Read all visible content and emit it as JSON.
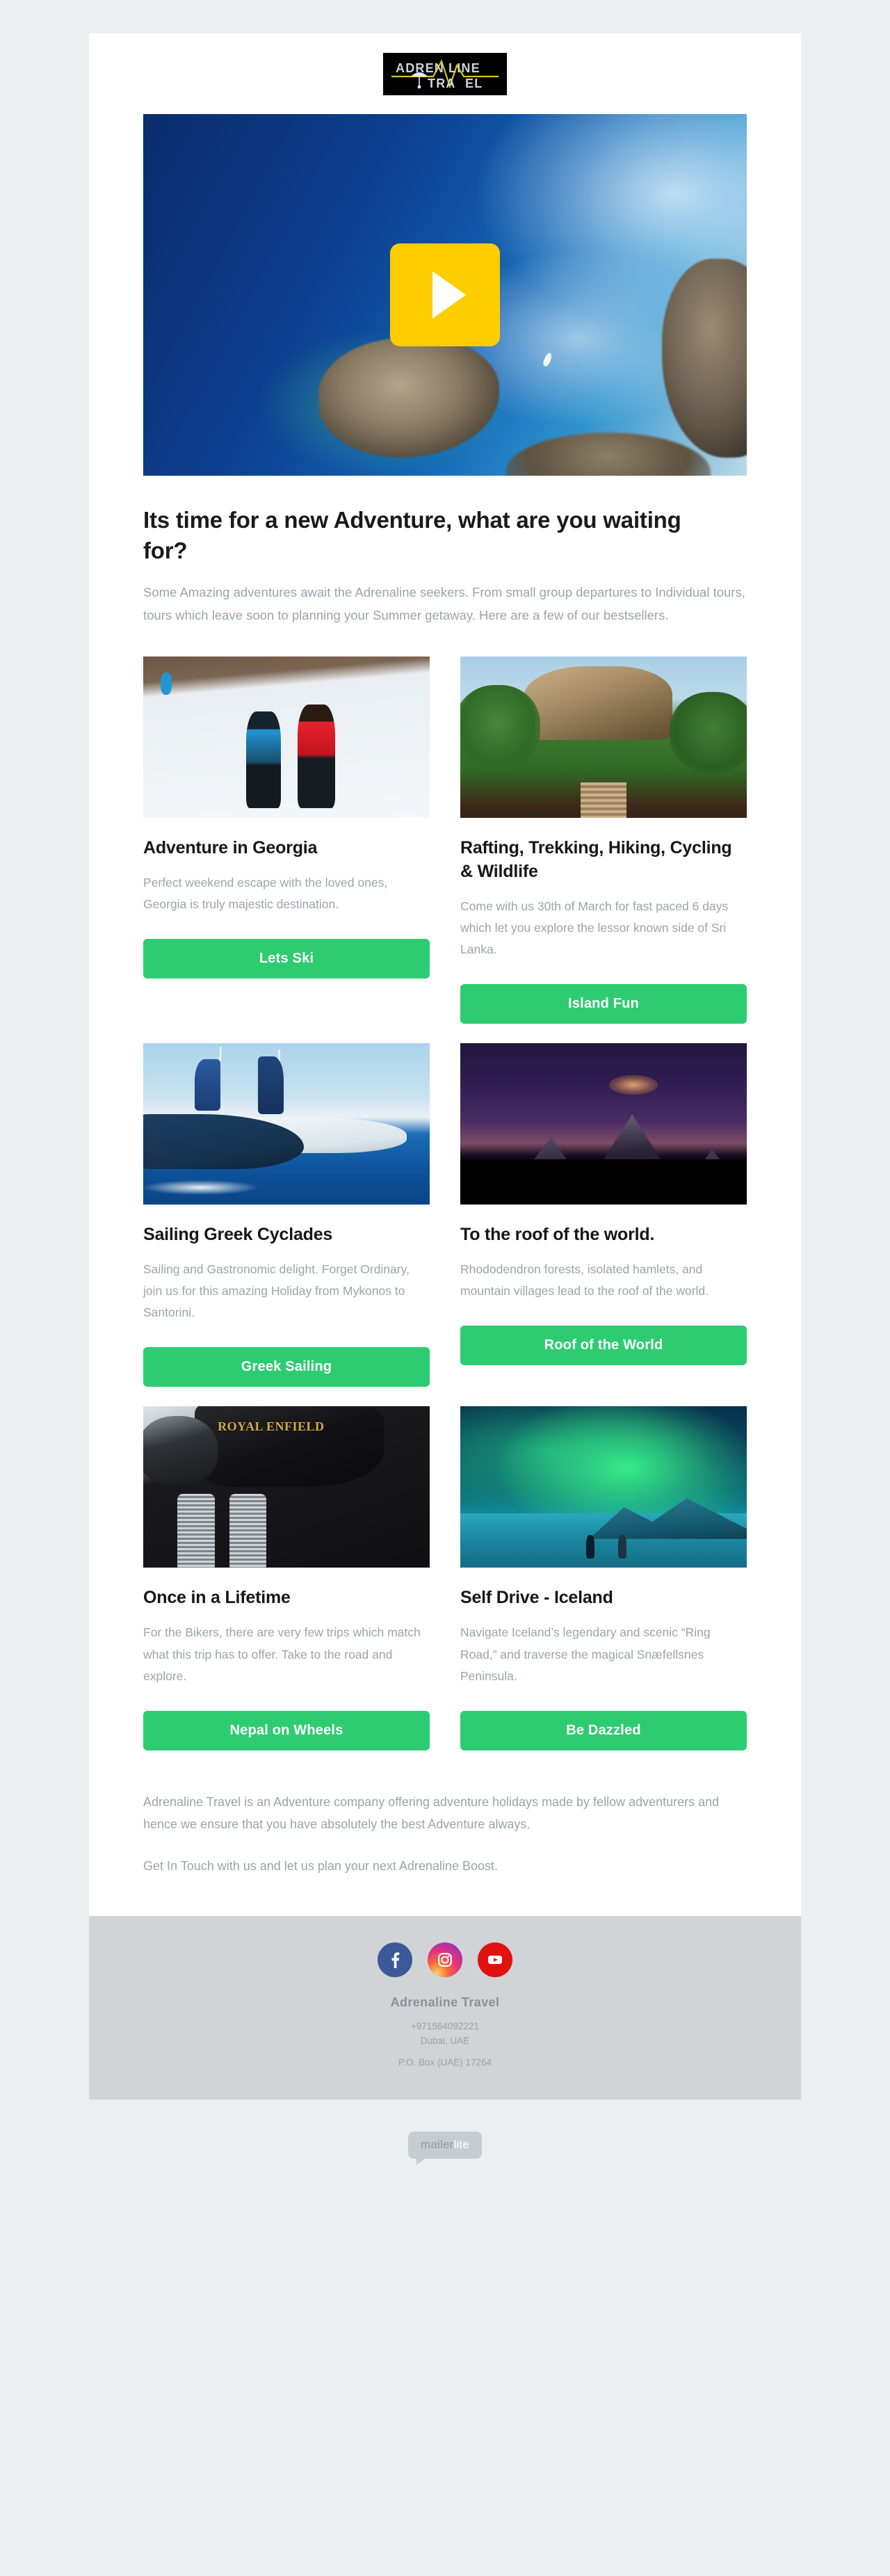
{
  "brand": {
    "logo_line1": "ADRENALINE",
    "logo_line2": "TRAVEL",
    "logo_alt": "adrenaline-travel-logo",
    "accent_green": "#2ecc71",
    "accent_yellow": "#ffcd00",
    "page_bg": "#eceff0",
    "footer_bg": "#d0d4d6"
  },
  "hero": {
    "alt": "aerial view of rocky coastline and deep blue ocean",
    "play_button_label": "Play video"
  },
  "intro": {
    "headline": "Its time for a new Adventure, what are you waiting for?",
    "body": "Some Amazing adventures await the Adrenaline seekers. From small group departures to Individual tours, tours which leave soon to planning your Summer getaway. Here are a few of our bestsellers."
  },
  "cards": [
    {
      "image_alt": "two cross-country skiers on a snowy trail",
      "title": "Adventure in Georgia",
      "description": "Perfect weekend escape with the loved ones, Georgia is truly majestic destination.",
      "cta_label": "Lets Ski"
    },
    {
      "image_alt": "Sigiriya rock fortress above green jungle, Sri Lanka",
      "title": "Rafting, Trekking, Hiking, Cycling & Wildlife",
      "description": "Come with us 30th of March for fast paced 6 days which let you explore the lessor known side of Sri Lanka.",
      "cta_label": "Island Fun"
    },
    {
      "image_alt": "sailing yachts with people on deck at sea",
      "title": "Sailing Greek Cyclades",
      "description": "Sailing and Gastronomic delight. Forget Ordinary, join us for this amazing Holiday from Mykonos to Santorini.",
      "cta_label": "Greek Sailing"
    },
    {
      "image_alt": "mountain peak under a purple twilight sky",
      "title": "To the roof of the world.",
      "description": "Rhododendron forests, isolated hamlets, and mountain villages lead to the roof of the world.",
      "cta_label": "Roof of the World"
    },
    {
      "image_alt": "close-up of a Royal Enfield motorcycle engine and tank",
      "image_text": "ROYAL ENFIELD",
      "title": "Once in a Lifetime",
      "description": "For the Bikers, there are very few trips which match what this trip has to offer. Take to the road and explore.",
      "cta_label": "Nepal on Wheels"
    },
    {
      "image_alt": "northern lights over an icy landscape with two people",
      "title": "Self Drive - Iceland",
      "description": "Navigate Iceland’s legendary and scenic “Ring Road,” and traverse the magical Snæfellsnes Peninsula.",
      "cta_label": "Be Dazzled"
    }
  ],
  "outro": {
    "paragraph1": "Adrenaline Travel is an Adventure company offering adventure holidays made by fellow adventurers and hence we ensure that you have absolutely the best Adventure always.",
    "paragraph2": "Get In Touch with us and let us plan your next Adrenaline Boost."
  },
  "footer": {
    "social": [
      {
        "name": "facebook",
        "label": "Facebook"
      },
      {
        "name": "instagram",
        "label": "Instagram"
      },
      {
        "name": "youtube",
        "label": "YouTube"
      }
    ],
    "company": "Adrenaline Travel",
    "phone": "+971564092221",
    "city": "Dubai, UAE",
    "pobox": "P.O. Box (UAE) 17264"
  },
  "badge": {
    "part1": "mailer",
    "part2": "lite"
  }
}
